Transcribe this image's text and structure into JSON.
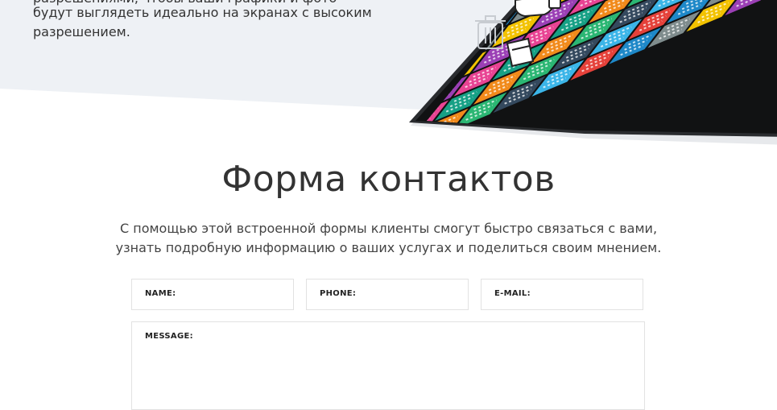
{
  "hero": {
    "line_clipped": "разрешениями, чтобы ваши графики и фото",
    "line_1": "будут выглядеть идеально на экранах с высоким",
    "line_2": "разрешением."
  },
  "contact": {
    "title": "Форма контактов",
    "description": "С помощью этой встроенной формы клиенты смогут быстро связаться с вами, узнать подробную информацию о ваших услугах и поделиться своим мнением.",
    "fields": {
      "name_label": "NAME:",
      "phone_label": "PHONE:",
      "email_label": "E-MAIL:",
      "message_label": "MESSAGE:"
    }
  },
  "colors": {
    "hero_bg": "#eef1f5",
    "tiles": [
      "#1e88c8",
      "#2bb673",
      "#9b3fb5",
      "#e5413a",
      "#f18a1b",
      "#f2c200",
      "#3bb5e8",
      "#16a085",
      "#7f8c8d",
      "#34495e",
      "#e84393"
    ]
  }
}
